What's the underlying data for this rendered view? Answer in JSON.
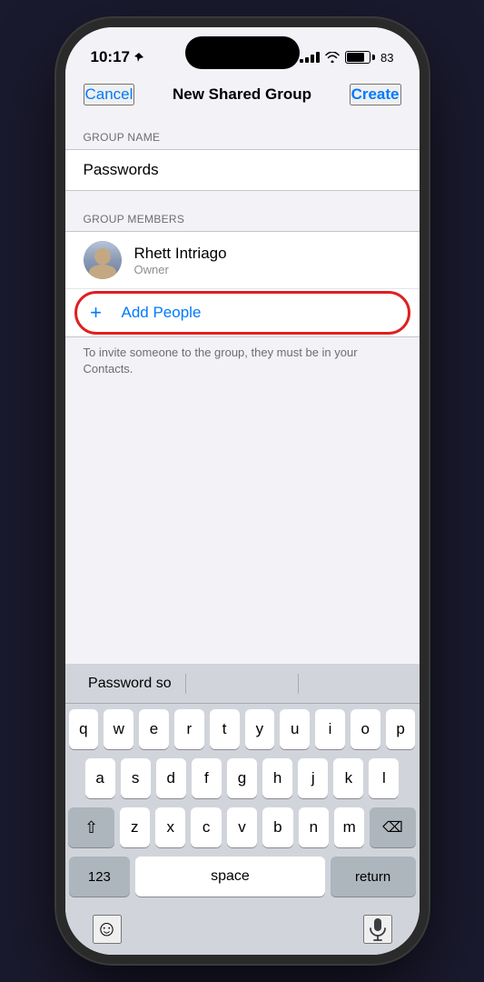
{
  "statusBar": {
    "time": "10:17",
    "battery": "83"
  },
  "navBar": {
    "cancelLabel": "Cancel",
    "title": "New Shared Group",
    "createLabel": "Create"
  },
  "groupName": {
    "sectionLabel": "GROUP NAME",
    "value": "Passwords"
  },
  "groupMembers": {
    "sectionLabel": "GROUP MEMBERS",
    "members": [
      {
        "name": "Rhett Intriago",
        "role": "Owner"
      }
    ],
    "addPeopleLabel": "Add People",
    "inviteHint": "To invite someone to the group, they must be in your Contacts."
  },
  "keyboard": {
    "autocomplete": [
      "Password so",
      "",
      ""
    ],
    "rows": [
      [
        "q",
        "w",
        "e",
        "r",
        "t",
        "y",
        "u",
        "i",
        "o",
        "p"
      ],
      [
        "a",
        "s",
        "d",
        "f",
        "g",
        "h",
        "j",
        "k",
        "l"
      ],
      [
        "⇧",
        "z",
        "x",
        "c",
        "v",
        "b",
        "n",
        "m",
        "⌫"
      ],
      [
        "123",
        "space",
        "return"
      ]
    ]
  }
}
